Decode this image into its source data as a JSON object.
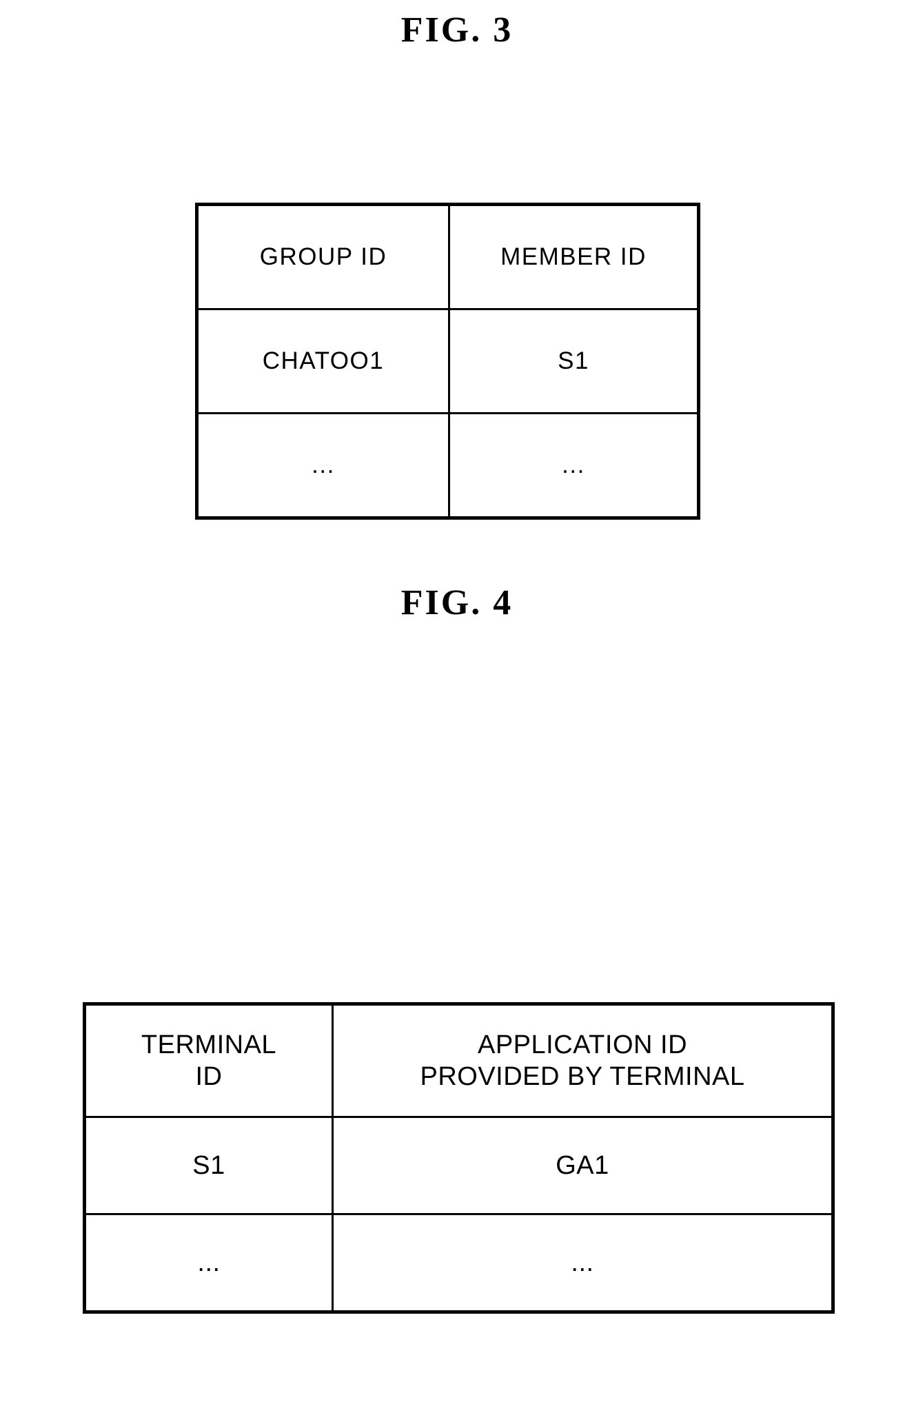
{
  "figures": [
    {
      "label": "FIG. 3",
      "table": {
        "columns": [
          "GROUP ID",
          "MEMBER ID"
        ],
        "rows": [
          [
            "CHATOO1",
            "S1"
          ],
          [
            "...",
            "..."
          ]
        ]
      }
    },
    {
      "label": "FIG. 4",
      "table": {
        "columns": [
          {
            "line1": "TERMINAL",
            "line2": "ID"
          },
          {
            "line1": "APPLICATION ID",
            "line2": "PROVIDED BY TERMINAL"
          }
        ],
        "rows": [
          [
            "S1",
            "GA1"
          ],
          [
            "...",
            "..."
          ]
        ]
      }
    }
  ],
  "colors": {
    "ink": "#000000",
    "page": "#ffffff"
  }
}
